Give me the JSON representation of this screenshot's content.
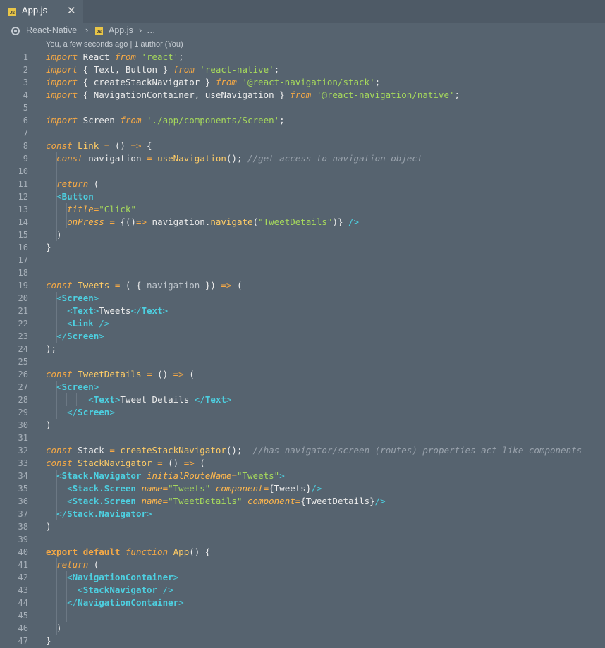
{
  "editor": {
    "tab": {
      "filename": "App.js",
      "icon": "js-file-icon",
      "close": "✕"
    },
    "breadcrumb": {
      "segments": [
        "React-Native",
        "›",
        "App.js",
        "›",
        "…"
      ]
    },
    "blame": "You, a few seconds ago | 1 author (You)",
    "colors": {
      "background": "#56636f",
      "keyword": "#f6a945",
      "string": "#a6d95c",
      "tag": "#4dd0e1",
      "comment": "#9aa3ad",
      "function": "#ffcc66"
    },
    "lines": [
      {
        "n": "1",
        "t": [
          [
            "kw",
            "import"
          ],
          [
            "pn",
            " React "
          ],
          [
            "kw",
            "from"
          ],
          [
            "pn",
            " "
          ],
          [
            "str",
            "'react'"
          ],
          [
            "pn",
            ";"
          ]
        ]
      },
      {
        "n": "2",
        "t": [
          [
            "kw",
            "import"
          ],
          [
            "pn",
            " { Text, Button } "
          ],
          [
            "kw",
            "from"
          ],
          [
            "pn",
            " "
          ],
          [
            "str",
            "'react-native'"
          ],
          [
            "pn",
            ";"
          ]
        ]
      },
      {
        "n": "3",
        "t": [
          [
            "kw",
            "import"
          ],
          [
            "pn",
            " { createStackNavigator } "
          ],
          [
            "kw",
            "from"
          ],
          [
            "pn",
            " "
          ],
          [
            "str",
            "'@react-navigation/stack'"
          ],
          [
            "pn",
            ";"
          ]
        ]
      },
      {
        "n": "4",
        "t": [
          [
            "kw",
            "import"
          ],
          [
            "pn",
            " { NavigationContainer, useNavigation } "
          ],
          [
            "kw",
            "from"
          ],
          [
            "pn",
            " "
          ],
          [
            "str",
            "'@react-navigation/native'"
          ],
          [
            "pn",
            ";"
          ]
        ]
      },
      {
        "n": "5",
        "t": []
      },
      {
        "n": "6",
        "t": [
          [
            "kw",
            "import"
          ],
          [
            "pn",
            " Screen "
          ],
          [
            "kw",
            "from"
          ],
          [
            "pn",
            " "
          ],
          [
            "str",
            "'./app/components/Screen'"
          ],
          [
            "pn",
            ";"
          ]
        ]
      },
      {
        "n": "7",
        "t": []
      },
      {
        "n": "8",
        "t": [
          [
            "kw",
            "const"
          ],
          [
            "pn",
            " "
          ],
          [
            "fn",
            "Link"
          ],
          [
            "pn",
            " "
          ],
          [
            "op",
            "="
          ],
          [
            "pn",
            " () "
          ],
          [
            "op",
            "=>"
          ],
          [
            "pn",
            " {"
          ]
        ]
      },
      {
        "n": "9",
        "t": [
          [
            "pn",
            "  "
          ],
          [
            "kw",
            "const"
          ],
          [
            "pn",
            " navigation "
          ],
          [
            "op",
            "="
          ],
          [
            "pn",
            " "
          ],
          [
            "fn",
            "useNavigation"
          ],
          [
            "pn",
            "(); "
          ],
          [
            "cmt",
            "//get access to navigation object"
          ]
        ]
      },
      {
        "n": "10",
        "t": []
      },
      {
        "n": "11",
        "t": [
          [
            "pn",
            "  "
          ],
          [
            "kw",
            "return"
          ],
          [
            "pn",
            " ("
          ]
        ]
      },
      {
        "n": "12",
        "t": [
          [
            "pn",
            "  "
          ],
          [
            "br",
            "<"
          ],
          [
            "tag",
            "Button"
          ]
        ]
      },
      {
        "n": "13",
        "t": [
          [
            "pn",
            "    "
          ],
          [
            "attr",
            "title"
          ],
          [
            "op",
            "="
          ],
          [
            "str",
            "\"Click\""
          ]
        ]
      },
      {
        "n": "14",
        "t": [
          [
            "pn",
            "    "
          ],
          [
            "attr",
            "onPress"
          ],
          [
            "pn",
            " "
          ],
          [
            "op",
            "="
          ],
          [
            "pn",
            " {()"
          ],
          [
            "op",
            "=>"
          ],
          [
            "pn",
            " navigation."
          ],
          [
            "fn",
            "navigate"
          ],
          [
            "pn",
            "("
          ],
          [
            "str",
            "\"TweetDetails\""
          ],
          [
            "pn",
            ")} "
          ],
          [
            "br",
            "/>"
          ]
        ]
      },
      {
        "n": "15",
        "t": [
          [
            "pn",
            "  )"
          ]
        ]
      },
      {
        "n": "16",
        "t": [
          [
            "pn",
            "}"
          ]
        ]
      },
      {
        "n": "17",
        "t": []
      },
      {
        "n": "18",
        "t": []
      },
      {
        "n": "19",
        "t": [
          [
            "kw",
            "const"
          ],
          [
            "pn",
            " "
          ],
          [
            "fn",
            "Tweets"
          ],
          [
            "pn",
            " "
          ],
          [
            "op",
            "="
          ],
          [
            "pn",
            " ( { "
          ],
          [
            "pr",
            "navigation"
          ],
          [
            "pn",
            " }) "
          ],
          [
            "op",
            "=>"
          ],
          [
            "pn",
            " ("
          ]
        ]
      },
      {
        "n": "20",
        "t": [
          [
            "pn",
            "  "
          ],
          [
            "br",
            "<"
          ],
          [
            "tag",
            "Screen"
          ],
          [
            "br",
            ">"
          ]
        ]
      },
      {
        "n": "21",
        "t": [
          [
            "pn",
            "    "
          ],
          [
            "br",
            "<"
          ],
          [
            "tag",
            "Text"
          ],
          [
            "br",
            ">"
          ],
          [
            "pn",
            "Tweets"
          ],
          [
            "br",
            "</"
          ],
          [
            "tag",
            "Text"
          ],
          [
            "br",
            ">"
          ]
        ]
      },
      {
        "n": "22",
        "t": [
          [
            "pn",
            "    "
          ],
          [
            "br",
            "<"
          ],
          [
            "tag",
            "Link"
          ],
          [
            "pn",
            " "
          ],
          [
            "br",
            "/>"
          ]
        ]
      },
      {
        "n": "23",
        "t": [
          [
            "pn",
            "  "
          ],
          [
            "br",
            "</"
          ],
          [
            "tag",
            "Screen"
          ],
          [
            "br",
            ">"
          ]
        ]
      },
      {
        "n": "24",
        "t": [
          [
            "pn",
            ");"
          ]
        ]
      },
      {
        "n": "25",
        "t": []
      },
      {
        "n": "26",
        "t": [
          [
            "kw",
            "const"
          ],
          [
            "pn",
            " "
          ],
          [
            "fn",
            "TweetDetails"
          ],
          [
            "pn",
            " "
          ],
          [
            "op",
            "="
          ],
          [
            "pn",
            " () "
          ],
          [
            "op",
            "=>"
          ],
          [
            "pn",
            " ("
          ]
        ]
      },
      {
        "n": "27",
        "t": [
          [
            "pn",
            "  "
          ],
          [
            "br",
            "<"
          ],
          [
            "tag",
            "Screen"
          ],
          [
            "br",
            ">"
          ]
        ]
      },
      {
        "n": "28",
        "t": [
          [
            "pn",
            "        "
          ],
          [
            "br",
            "<"
          ],
          [
            "tag",
            "Text"
          ],
          [
            "br",
            ">"
          ],
          [
            "pn",
            "Tweet Details "
          ],
          [
            "br",
            "</"
          ],
          [
            "tag",
            "Text"
          ],
          [
            "br",
            ">"
          ]
        ]
      },
      {
        "n": "29",
        "t": [
          [
            "pn",
            "    "
          ],
          [
            "br",
            "</"
          ],
          [
            "tag",
            "Screen"
          ],
          [
            "br",
            ">"
          ]
        ]
      },
      {
        "n": "30",
        "t": [
          [
            "pn",
            ")"
          ]
        ]
      },
      {
        "n": "31",
        "t": []
      },
      {
        "n": "32",
        "t": [
          [
            "kw",
            "const"
          ],
          [
            "pn",
            " Stack "
          ],
          [
            "op",
            "="
          ],
          [
            "pn",
            " "
          ],
          [
            "fn",
            "createStackNavigator"
          ],
          [
            "pn",
            "();  "
          ],
          [
            "cmt",
            "//has navigator/screen (routes) properties act like components"
          ]
        ]
      },
      {
        "n": "33",
        "t": [
          [
            "kw",
            "const"
          ],
          [
            "pn",
            " "
          ],
          [
            "fn",
            "StackNavigator"
          ],
          [
            "pn",
            " "
          ],
          [
            "op",
            "="
          ],
          [
            "pn",
            " () "
          ],
          [
            "op",
            "=>"
          ],
          [
            "pn",
            " ("
          ]
        ]
      },
      {
        "n": "34",
        "t": [
          [
            "pn",
            "  "
          ],
          [
            "br",
            "<"
          ],
          [
            "tag",
            "Stack.Navigator"
          ],
          [
            "pn",
            " "
          ],
          [
            "attr",
            "initialRouteName"
          ],
          [
            "op",
            "="
          ],
          [
            "str",
            "\"Tweets\""
          ],
          [
            "br",
            ">"
          ]
        ]
      },
      {
        "n": "35",
        "t": [
          [
            "pn",
            "    "
          ],
          [
            "br",
            "<"
          ],
          [
            "tag",
            "Stack.Screen"
          ],
          [
            "pn",
            " "
          ],
          [
            "attr",
            "name"
          ],
          [
            "op",
            "="
          ],
          [
            "str",
            "\"Tweets\""
          ],
          [
            "pn",
            " "
          ],
          [
            "attr",
            "component"
          ],
          [
            "op",
            "="
          ],
          [
            "pn",
            "{Tweets}"
          ],
          [
            "br",
            "/>"
          ]
        ]
      },
      {
        "n": "36",
        "t": [
          [
            "pn",
            "    "
          ],
          [
            "br",
            "<"
          ],
          [
            "tag",
            "Stack.Screen"
          ],
          [
            "pn",
            " "
          ],
          [
            "attr",
            "name"
          ],
          [
            "op",
            "="
          ],
          [
            "str",
            "\"TweetDetails\""
          ],
          [
            "pn",
            " "
          ],
          [
            "attr",
            "component"
          ],
          [
            "op",
            "="
          ],
          [
            "pn",
            "{TweetDetails}"
          ],
          [
            "br",
            "/>"
          ]
        ]
      },
      {
        "n": "37",
        "t": [
          [
            "pn",
            "  "
          ],
          [
            "br",
            "</"
          ],
          [
            "tag",
            "Stack.Navigator"
          ],
          [
            "br",
            ">"
          ]
        ]
      },
      {
        "n": "38",
        "t": [
          [
            "pn",
            ")"
          ]
        ]
      },
      {
        "n": "39",
        "t": []
      },
      {
        "n": "40",
        "t": [
          [
            "kwb",
            "export"
          ],
          [
            "pn",
            " "
          ],
          [
            "kwb",
            "default"
          ],
          [
            "pn",
            " "
          ],
          [
            "kw",
            "function"
          ],
          [
            "pn",
            " "
          ],
          [
            "fn",
            "App"
          ],
          [
            "pn",
            "() {"
          ]
        ]
      },
      {
        "n": "41",
        "t": [
          [
            "pn",
            "  "
          ],
          [
            "kw",
            "return"
          ],
          [
            "pn",
            " ("
          ]
        ]
      },
      {
        "n": "42",
        "t": [
          [
            "pn",
            "    "
          ],
          [
            "br",
            "<"
          ],
          [
            "tag",
            "NavigationContainer"
          ],
          [
            "br",
            ">"
          ]
        ]
      },
      {
        "n": "43",
        "t": [
          [
            "pn",
            "      "
          ],
          [
            "br",
            "<"
          ],
          [
            "tag",
            "StackNavigator"
          ],
          [
            "pn",
            " "
          ],
          [
            "br",
            "/>"
          ]
        ]
      },
      {
        "n": "44",
        "t": [
          [
            "pn",
            "    "
          ],
          [
            "br",
            "</"
          ],
          [
            "tag",
            "NavigationContainer"
          ],
          [
            "br",
            ">"
          ]
        ]
      },
      {
        "n": "45",
        "t": []
      },
      {
        "n": "46",
        "t": [
          [
            "pn",
            "  )"
          ]
        ]
      },
      {
        "n": "47",
        "t": [
          [
            "pn",
            "}"
          ]
        ]
      }
    ]
  }
}
